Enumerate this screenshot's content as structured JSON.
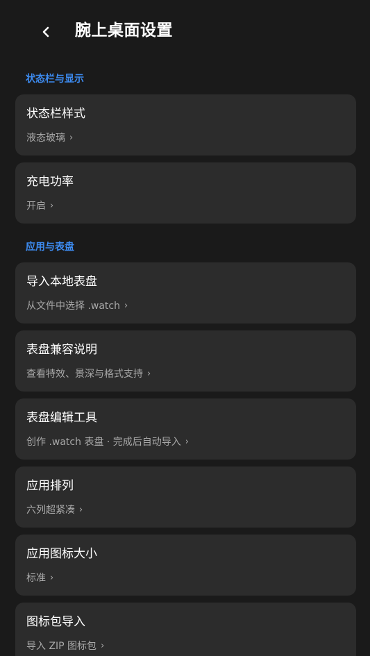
{
  "header": {
    "title": "腕上桌面设置",
    "back_icon": "chevron-left-icon"
  },
  "sections": [
    {
      "label": "状态栏与显示",
      "items": [
        {
          "title": "状态栏样式",
          "subtitle": "液态玻璃"
        },
        {
          "title": "充电功率",
          "subtitle": "开启"
        }
      ]
    },
    {
      "label": "应用与表盘",
      "items": [
        {
          "title": "导入本地表盘",
          "subtitle": "从文件中选择 .watch"
        },
        {
          "title": "表盘兼容说明",
          "subtitle": "查看特效、景深与格式支持"
        },
        {
          "title": "表盘编辑工具",
          "subtitle": "创作 .watch 表盘 · 完成后自动导入"
        },
        {
          "title": "应用排列",
          "subtitle": "六列超紧凑"
        },
        {
          "title": "应用图标大小",
          "subtitle": "标准"
        },
        {
          "title": "图标包导入",
          "subtitle": "导入 ZIP 图标包"
        }
      ]
    }
  ],
  "chevron_glyph": "›",
  "colors": {
    "background": "#1a1a1a",
    "card": "#2c2c2c",
    "accent": "#3d8bf0",
    "subtitle": "#a8a8a8"
  }
}
